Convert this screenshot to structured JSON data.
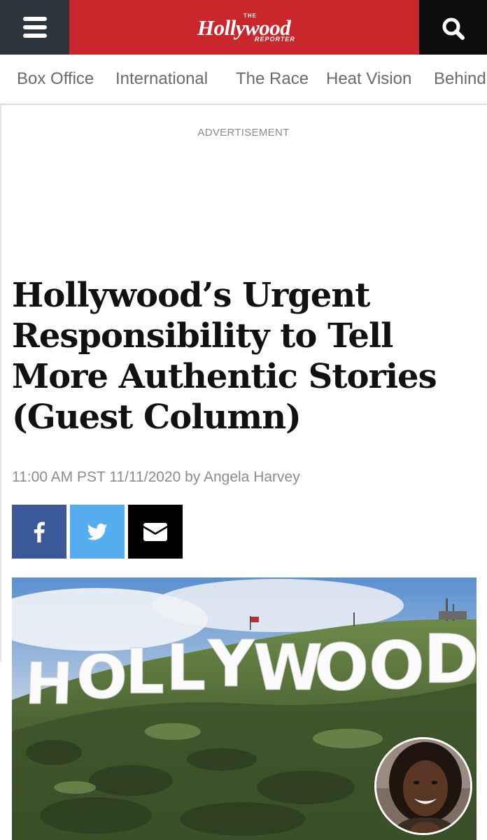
{
  "header": {
    "logo_the": "THE",
    "logo_main": "Hollywood",
    "logo_reporter": "REPORTER",
    "menu_icon": "hamburger-icon",
    "search_icon": "search-icon",
    "colors": {
      "brand_red": "#c9272b",
      "menu_bg": "#2c353c",
      "search_bg": "#0d0d0d"
    }
  },
  "nav": {
    "items": [
      {
        "label": "Box Office"
      },
      {
        "label": "International"
      },
      {
        "label": "The Race"
      },
      {
        "label": "Heat Vision"
      },
      {
        "label": "Behind"
      }
    ]
  },
  "ad": {
    "label": "ADVERTISEMENT"
  },
  "article": {
    "headline_lines": [
      "Hollywood’s Urgent",
      "Responsibility to Tell",
      "More Authentic Stories",
      "(Guest Column)"
    ],
    "byline": "11:00 AM PST 11/11/2020 by Angela Harvey"
  },
  "share": {
    "buttons": [
      {
        "icon": "facebook-icon",
        "color": "#3b5998"
      },
      {
        "icon": "twitter-icon",
        "color": "#55acee"
      },
      {
        "icon": "email-icon",
        "color": "#000000"
      }
    ]
  },
  "hero": {
    "sign_text": "HOLLYWOOD",
    "avatar_icon": "author-avatar"
  }
}
